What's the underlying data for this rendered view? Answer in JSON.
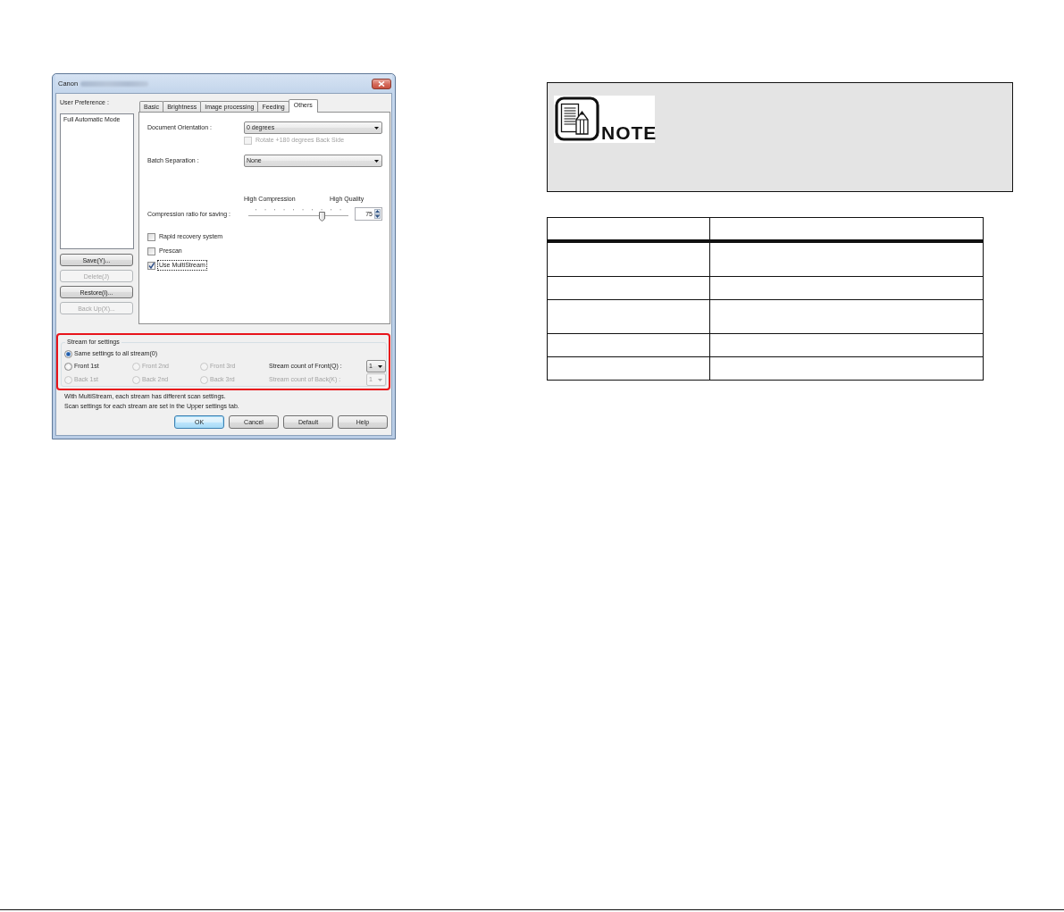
{
  "dialog": {
    "title": "Canon",
    "user_preference": {
      "label": "User Preference :",
      "items": [
        {
          "label": "Full Automatic Mode",
          "selected": false
        }
      ],
      "buttons": [
        {
          "label": "Save(Y)...",
          "disabled": false
        },
        {
          "label": "Delete(J)",
          "disabled": true
        },
        {
          "label": "Restore(I)...",
          "disabled": false
        },
        {
          "label": "Back Up(X)...",
          "disabled": true
        }
      ]
    },
    "tabs": [
      {
        "label": "Basic",
        "selected": false
      },
      {
        "label": "Brightness",
        "selected": false
      },
      {
        "label": "Image processing",
        "selected": false
      },
      {
        "label": "Feeding",
        "selected": false
      },
      {
        "label": "Others",
        "selected": true
      }
    ],
    "others_tab": {
      "document_orientation": {
        "label": "Document Orientation :",
        "value": "0 degrees"
      },
      "rotate_back_side": {
        "label": "Rotate +180 degrees Back Side",
        "checked": false,
        "disabled": true
      },
      "batch_separation": {
        "label": "Batch Separation :",
        "value": "None"
      },
      "compression": {
        "label": "Compression ratio for saving :",
        "left_caption": "High Compression",
        "right_caption": "High Quality",
        "level": 0.74,
        "value": "75"
      },
      "options": [
        {
          "label": "Rapid recovery system",
          "checked": false,
          "focused": false
        },
        {
          "label": "Prescan",
          "checked": false,
          "focused": false
        },
        {
          "label": "Use MultiStream",
          "checked": true,
          "focused": true
        }
      ]
    },
    "stream_settings": {
      "highlighted": true,
      "title": "Stream for settings",
      "same_for_all": {
        "label": "Same settings to all stream(0)",
        "selected": true,
        "disabled": false
      },
      "rows": [
        {
          "radios": [
            {
              "label": "Front 1st",
              "selected": false,
              "disabled": false
            },
            {
              "label": "Front 2nd",
              "selected": false,
              "disabled": true
            },
            {
              "label": "Front 3rd",
              "selected": false,
              "disabled": true
            }
          ],
          "count": {
            "label": "Stream count of Front(Q) :",
            "value": "1",
            "disabled": false
          }
        },
        {
          "radios": [
            {
              "label": "Back 1st",
              "selected": false,
              "disabled": true
            },
            {
              "label": "Back 2nd",
              "selected": false,
              "disabled": true
            },
            {
              "label": "Back 3rd",
              "selected": false,
              "disabled": true
            }
          ],
          "count": {
            "label": "Stream count of Back(K) :",
            "value": "1",
            "disabled": true
          }
        }
      ]
    },
    "info_lines": [
      "With MultiStream, each stream has different scan settings.",
      "Scan settings for each stream are set in the Upper settings tab."
    ],
    "buttons": [
      {
        "label": "OK",
        "default": true
      },
      {
        "label": "Cancel",
        "default": false
      },
      {
        "label": "Default",
        "default": false
      },
      {
        "label": "Help",
        "default": false
      }
    ]
  },
  "note": {
    "label": "NOTE"
  },
  "table": {
    "rows": [
      {
        "kind": "header"
      },
      {
        "kind": "tall"
      },
      {
        "kind": "short"
      },
      {
        "kind": "tall"
      },
      {
        "kind": "short"
      },
      {
        "kind": "short"
      }
    ]
  }
}
